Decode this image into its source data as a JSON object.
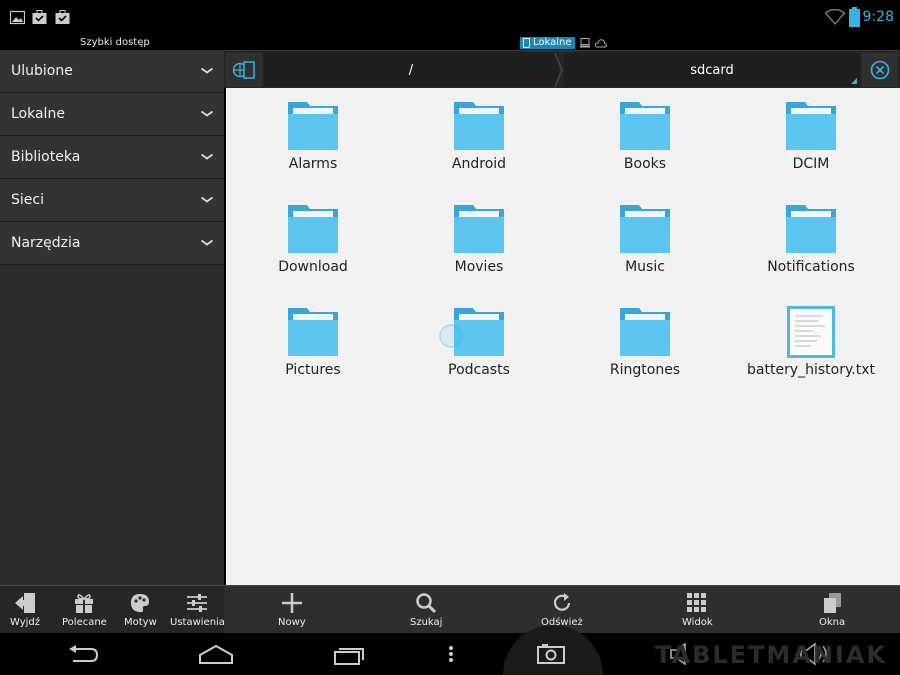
{
  "status_bar": {
    "time": "9:28",
    "icons": [
      "image-icon",
      "briefcase-check-icon",
      "briefcase-check-icon",
      "wifi-icon",
      "battery-icon"
    ]
  },
  "header": {
    "quick_access_title": "Szybki dostęp",
    "location_tabs": [
      {
        "label": "Lokalne",
        "icon": "tablet-icon",
        "active": true
      },
      {
        "label": "",
        "icon": "computer-icon",
        "active": false
      },
      {
        "label": "",
        "icon": "cloud-icon",
        "active": false
      }
    ]
  },
  "sidebar": {
    "items": [
      {
        "label": "Ulubione"
      },
      {
        "label": "Lokalne"
      },
      {
        "label": "Biblioteka"
      },
      {
        "label": "Sieci"
      },
      {
        "label": "Narzędzia"
      }
    ]
  },
  "path_bar": {
    "segments": [
      "/",
      "sdcard"
    ]
  },
  "files": [
    {
      "name": "Alarms",
      "type": "folder"
    },
    {
      "name": "Android",
      "type": "folder"
    },
    {
      "name": "Books",
      "type": "folder"
    },
    {
      "name": "DCIM",
      "type": "folder"
    },
    {
      "name": "Download",
      "type": "folder"
    },
    {
      "name": "Movies",
      "type": "folder"
    },
    {
      "name": "Music",
      "type": "folder"
    },
    {
      "name": "Notifications",
      "type": "folder"
    },
    {
      "name": "Pictures",
      "type": "folder"
    },
    {
      "name": "Podcasts",
      "type": "folder"
    },
    {
      "name": "Ringtones",
      "type": "folder"
    },
    {
      "name": "battery_history.txt",
      "type": "file"
    }
  ],
  "toolbar": {
    "left": [
      {
        "label": "Wyjdź",
        "icon": "exit-icon"
      },
      {
        "label": "Polecane",
        "icon": "gift-icon"
      },
      {
        "label": "Motyw",
        "icon": "palette-icon"
      },
      {
        "label": "Ustawienia",
        "icon": "sliders-icon"
      }
    ],
    "right": [
      {
        "label": "Nowy",
        "icon": "plus-icon"
      },
      {
        "label": "Szukaj",
        "icon": "search-icon"
      },
      {
        "label": "Odśwież",
        "icon": "refresh-icon"
      },
      {
        "label": "Widok",
        "icon": "grid-view-icon"
      },
      {
        "label": "Okna",
        "icon": "windows-icon"
      }
    ]
  },
  "watermark": "TABLETMANIAK",
  "colors": {
    "accent": "#33b5e5",
    "folder": "#5bc4ef",
    "folder_dark": "#3aa6d8"
  }
}
